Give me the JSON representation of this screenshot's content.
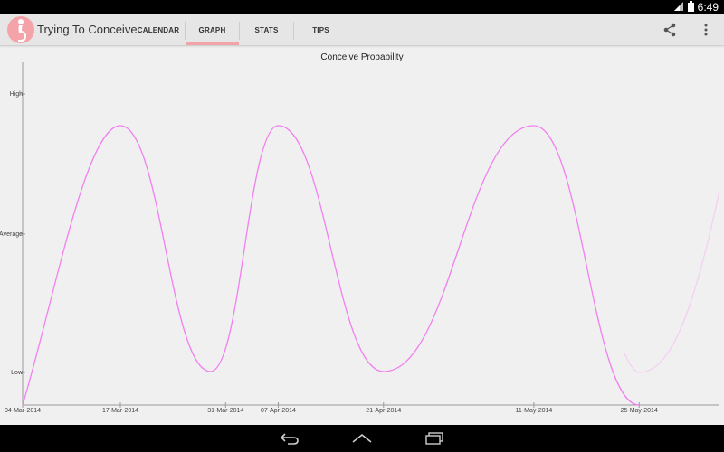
{
  "status_bar": {
    "time": "6:49"
  },
  "app": {
    "title": "Trying To Conceive"
  },
  "tabs": [
    {
      "label": "CALENDAR",
      "selected": false
    },
    {
      "label": "GRAPH",
      "selected": true
    },
    {
      "label": "STATS",
      "selected": false
    },
    {
      "label": "TIPS",
      "selected": false
    }
  ],
  "actions": {
    "share": "share-icon",
    "overflow": "overflow-menu-icon"
  },
  "colors": {
    "accent": "#f1a4a8",
    "curve": "#f27ff0",
    "curve_faded": "#f4cff3"
  },
  "chart_data": {
    "type": "line",
    "title": "Conceive Probability",
    "y_levels": [
      "Low",
      "Average",
      "High"
    ],
    "x_tick_labels": [
      "04-Mar-2014",
      "17-Mar-2014",
      "31-Mar-2014",
      "07-Apr-2014",
      "21-Apr-2014",
      "11-May-2014",
      "25-May-2014"
    ],
    "x_tick_dates": [
      "2014-03-04",
      "2014-03-17",
      "2014-03-31",
      "2014-04-07",
      "2014-04-21",
      "2014-05-11",
      "2014-05-25"
    ],
    "xlim": [
      "2014-03-04",
      "2014-06-01"
    ],
    "ylim": [
      "Low",
      "High"
    ],
    "series": [
      {
        "style": "solid",
        "points": [
          [
            "2014-03-04",
            "Low"
          ],
          [
            "2014-03-17",
            "High"
          ],
          [
            "2014-03-29",
            "Low"
          ],
          [
            "2014-04-07",
            "High"
          ],
          [
            "2014-04-21",
            "Low"
          ],
          [
            "2014-05-11",
            "High"
          ],
          [
            "2014-05-25",
            "Low"
          ]
        ]
      },
      {
        "style": "faded",
        "points": [
          [
            "2014-05-25",
            "Low"
          ],
          [
            "2014-06-01",
            "Average"
          ]
        ]
      }
    ]
  },
  "nav": {
    "back": "back-icon",
    "home": "home-icon",
    "recents": "recents-icon"
  }
}
